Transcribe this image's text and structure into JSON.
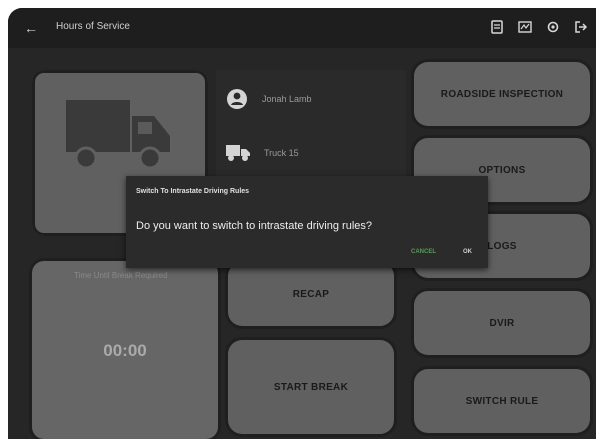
{
  "app": {
    "title": "Hours of Service"
  },
  "top_icons": [
    "document-icon",
    "logs-icon",
    "settings-icon",
    "logout-icon"
  ],
  "info": {
    "user_name": "Jonah Lamb",
    "truck_label": "Truck 15"
  },
  "timer": {
    "caption": "Time Until Break Required",
    "value": "00:00"
  },
  "buttons": {
    "roadside_inspection": "ROADSIDE INSPECTION",
    "options": "OPTIONS",
    "logs": "LOGS",
    "recap": "RECAP",
    "dvir": "DVIR",
    "start_break": "START BREAK",
    "switch_rule": "SWITCH RULE"
  },
  "dialog": {
    "title": "Switch To Intrastate Driving Rules",
    "message": "Do you want to switch to intrastate driving rules?",
    "cancel": "CANCEL",
    "ok": "OK"
  }
}
